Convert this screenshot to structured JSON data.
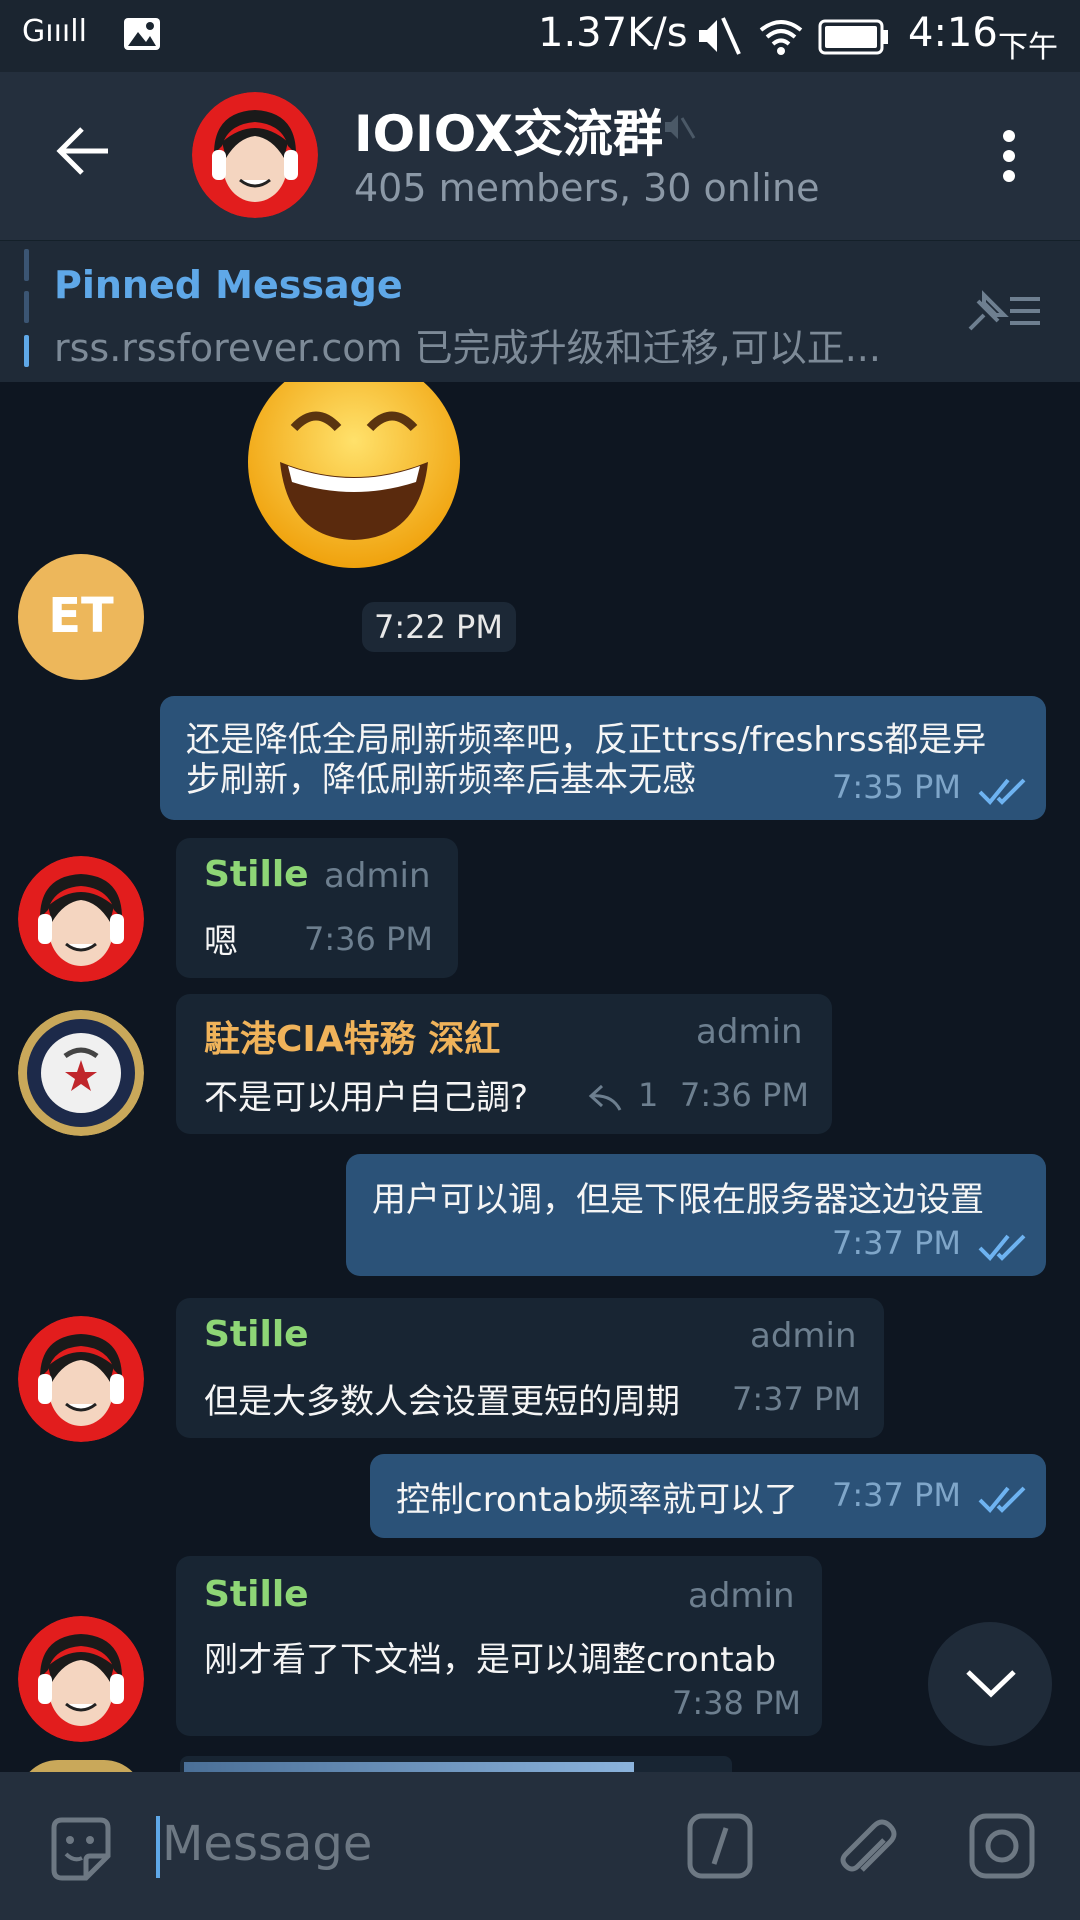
{
  "status_bar": {
    "signal": "Gıııll",
    "speed": "1.37K/s",
    "time": "4:16",
    "ampm": "下午"
  },
  "header": {
    "title": "IOIOX交流群",
    "subtitle": "405 members, 30 online"
  },
  "pinned": {
    "title": "Pinned Message",
    "text": "rss.rssforever.com 已完成升级和迁移,可以正..."
  },
  "messages": [
    {
      "avatar_text": "ET",
      "time": "7:22 PM"
    },
    {
      "text_line1": "还是降低全局刷新频率吧，反正ttrss/freshrss都是异",
      "text_line2": "步刷新，降低刷新频率后基本无感",
      "time": "7:35 PM"
    },
    {
      "sender": "Stille",
      "role": "admin",
      "text": "嗯",
      "time": "7:36 PM"
    },
    {
      "sender": "駐港CIA特務 深紅",
      "role": "admin",
      "text": "不是可以用户自己調?",
      "reply_count": "1",
      "time": "7:36 PM"
    },
    {
      "text": "用户可以调，但是下限在服务器这边设置",
      "time": "7:37 PM"
    },
    {
      "sender": "Stille",
      "role": "admin",
      "text": "但是大多数人会设置更短的周期",
      "time": "7:37 PM"
    },
    {
      "text": "控制crontab频率就可以了",
      "time": "7:37 PM"
    },
    {
      "sender": "Stille",
      "role": "admin",
      "text": "刚才看了下文档，是可以调整crontab",
      "time": "7:38 PM"
    }
  ],
  "input": {
    "placeholder": "Message"
  },
  "colors": {
    "header_bg": "#242f3d",
    "chat_bg": "#0e1621",
    "bubble_in": "#182533",
    "bubble_out": "#2b5278",
    "accent": "#5fa8e8",
    "sender_green": "#8ed676",
    "sender_orange": "#f0b35a"
  }
}
